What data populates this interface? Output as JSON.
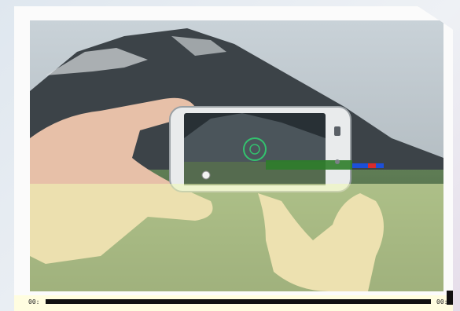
{
  "video_player": {
    "time_elapsed": "00:",
    "time_total": "00:",
    "progress": 0.0
  },
  "colors": {
    "overlay": "#f0fab4",
    "progress_track": "#111111",
    "frame": "#fbfbfb"
  },
  "icons": {
    "phone_shutter": "camera-shutter-icon",
    "phone_focus": "focus-reticle-icon"
  }
}
